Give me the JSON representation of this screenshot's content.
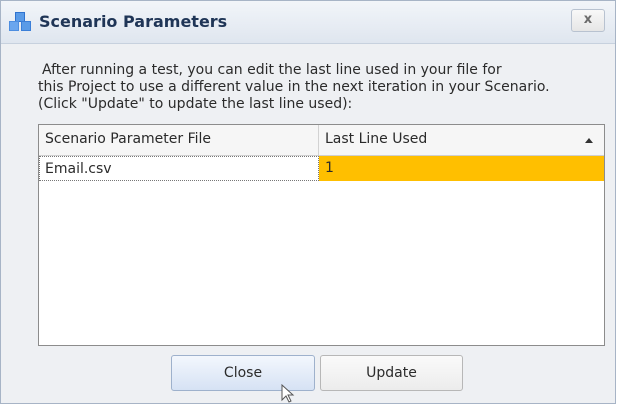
{
  "window": {
    "title": "Scenario Parameters",
    "close_glyph": "x",
    "app_icon": "scenario-cubes-icon"
  },
  "description": {
    "line1": "After running a test, you can edit the last line used in your file for",
    "line2": "this Project to use a different value in the next iteration in your Scenario.",
    "line3": "(Click \"Update\" to update the last line used):"
  },
  "table": {
    "columns": [
      "Scenario Parameter File",
      "Last Line Used"
    ],
    "sort_indicator": "ascending",
    "rows": [
      {
        "file": "Email.csv",
        "last_line": "1"
      }
    ]
  },
  "buttons": {
    "close": "Close",
    "update": "Update"
  },
  "colors": {
    "selection_highlight": "#ffbf00",
    "title_text": "#1f3556",
    "icon_blue": "#4d8ee0"
  }
}
